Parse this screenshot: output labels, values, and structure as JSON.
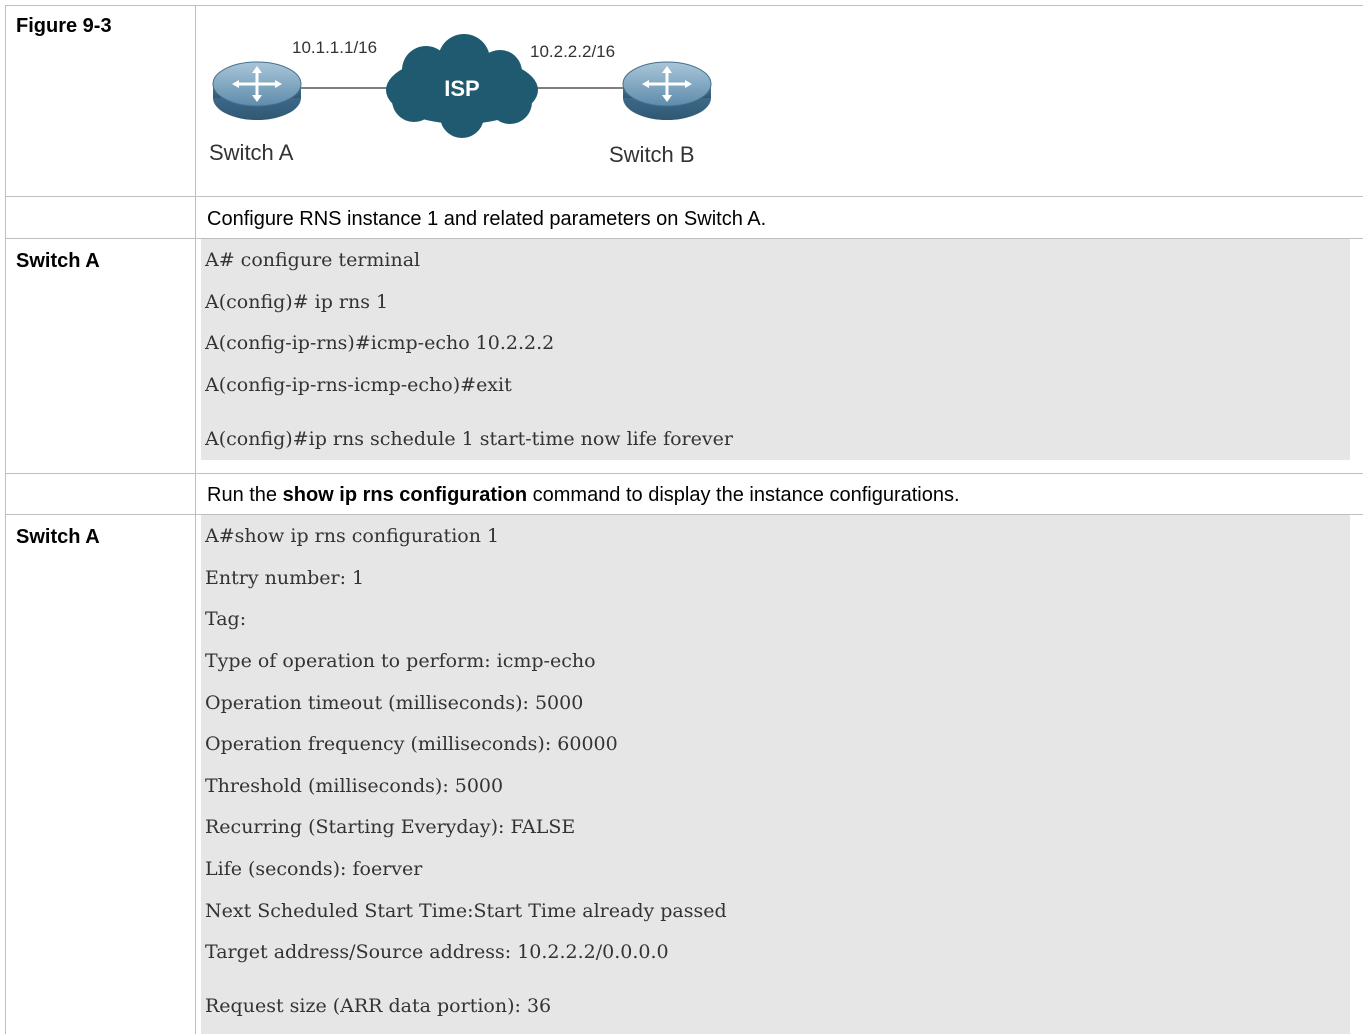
{
  "figure": {
    "label": "Figure 9-3",
    "diagram": {
      "switch_a_ip": "10.1.1.1/16",
      "switch_b_ip": "10.2.2.2/16",
      "cloud_label": "ISP",
      "switch_a_name": "Switch A",
      "switch_b_name": "Switch B"
    }
  },
  "step1": {
    "description": "Configure RNS instance 1 and related parameters on Switch A.",
    "device": "Switch A",
    "code": [
      "A# configure terminal",
      "A(config)# ip rns 1",
      "A(config-ip-rns)#icmp-echo 10.2.2.2",
      "A(config-ip-rns-icmp-echo)#exit",
      "A(config)#ip rns schedule 1 start-time now life forever"
    ]
  },
  "step2": {
    "description_prefix": "Run the ",
    "description_bold": "show ip rns configuration",
    "description_suffix": " command to display the instance configurations.",
    "device": "Switch A",
    "code": [
      "A#show ip rns configuration 1",
      "Entry number: 1",
      "Tag:",
      "Type of operation to perform: icmp-echo",
      "Operation timeout (milliseconds): 5000",
      "Operation frequency (milliseconds): 60000",
      "Threshold (milliseconds): 5000",
      "Recurring (Starting Everyday): FALSE",
      "Life (seconds): foerver",
      "Next Scheduled Start Time:Start Time already passed",
      "Target address/Source address: 10.2.2.2/0.0.0.0",
      "Request size (ARR data portion): 36"
    ]
  },
  "colors": {
    "border": "#bfbfbf",
    "code_background": "#e6e6e6",
    "router_blue": "#3f6f8f",
    "cloud_teal": "#1f5a70"
  }
}
